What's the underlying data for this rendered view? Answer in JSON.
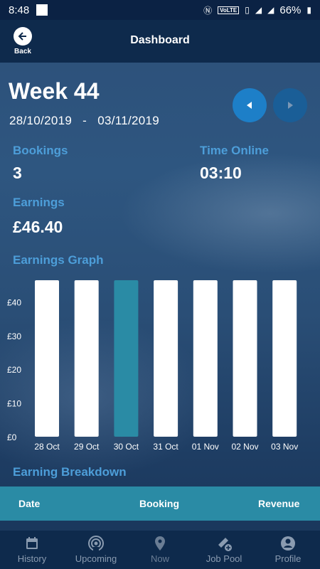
{
  "status_bar": {
    "time": "8:48",
    "network_badge": "VoLTE",
    "battery": "66%"
  },
  "app_bar": {
    "title": "Dashboard",
    "back_label": "Back"
  },
  "week": {
    "title": "Week 44",
    "start_date": "28/10/2019",
    "separator": "-",
    "end_date": "03/11/2019"
  },
  "stats": {
    "bookings_label": "Bookings",
    "bookings_value": "3",
    "time_online_label": "Time Online",
    "time_online_value": "03:10",
    "earnings_label": "Earnings",
    "earnings_value": "£46.40"
  },
  "graph_title": "Earnings Graph",
  "chart_data": {
    "type": "bar",
    "categories": [
      "28 Oct",
      "29 Oct",
      "30 Oct",
      "31 Oct",
      "01 Nov",
      "02 Nov",
      "03 Nov"
    ],
    "values": [
      46.4,
      46.4,
      46.4,
      46.4,
      46.4,
      46.4,
      46.4
    ],
    "highlight_index": 2,
    "y_ticks": [
      "£0",
      "£10",
      "£20",
      "£30",
      "£40"
    ],
    "ylim": [
      0,
      46.4
    ],
    "colors": {
      "bar": "#ffffff",
      "highlight": "#2a8ba5",
      "tick_text": "#ffffff"
    }
  },
  "breakdown": {
    "title": "Earning Breakdown",
    "columns": [
      "Date",
      "Booking",
      "Revenue"
    ]
  },
  "bottom_nav": [
    {
      "label": "History",
      "icon": "calendar-icon"
    },
    {
      "label": "Upcoming",
      "icon": "broadcast-icon"
    },
    {
      "label": "Now",
      "icon": "location-pin-icon"
    },
    {
      "label": "Job Pool",
      "icon": "ticket-add-icon"
    },
    {
      "label": "Profile",
      "icon": "account-circle-icon"
    }
  ],
  "colors": {
    "accent": "#4d9ed9",
    "nav_bg": "#0e2a4c",
    "table_header": "#2a8ba5"
  }
}
